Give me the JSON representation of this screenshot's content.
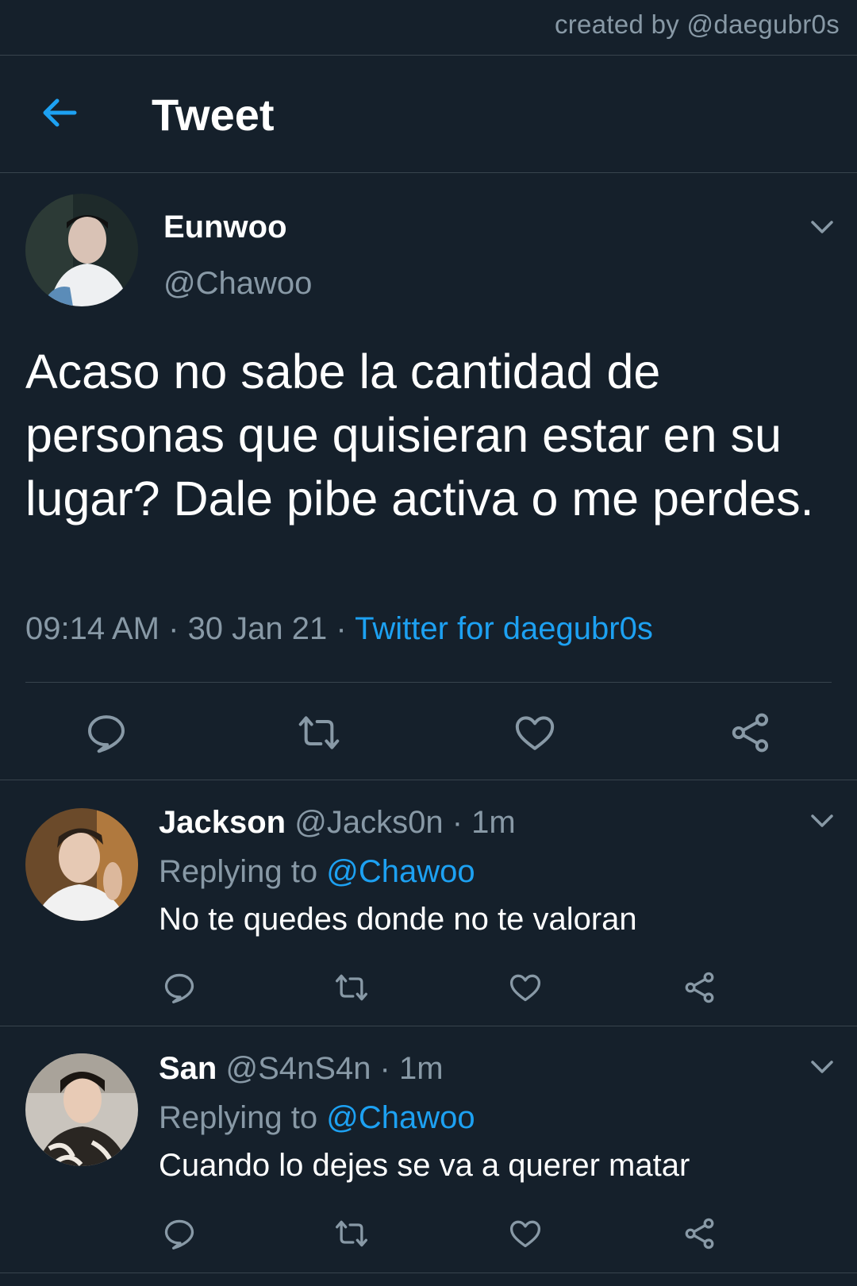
{
  "credit": "created by @daegubr0s",
  "header": {
    "title": "Tweet",
    "back_icon": "arrow-left-icon"
  },
  "colors": {
    "background": "#15202b",
    "accent": "#1da1f2",
    "muted": "#8899a6",
    "divider": "#38444d"
  },
  "main_tweet": {
    "name": "Eunwoo",
    "handle": "@Chawoo",
    "text": "Acaso no sabe la cantidad de personas que quisieran estar en su lugar? Dale pibe activa o me perdes.",
    "time": "09:14 AM",
    "sep1": " · ",
    "date": "30 Jan 21",
    "sep2": " · ",
    "source": "Twitter for daegubr0s",
    "actions": [
      "reply-icon",
      "retweet-icon",
      "like-icon",
      "share-icon"
    ]
  },
  "replies": [
    {
      "name": "Jackson",
      "handle": "@Jacks0n",
      "time": " · 1m",
      "replying_prefix": "Replying to ",
      "replying_to": "@Chawoo",
      "text": "No te quedes donde no te valoran"
    },
    {
      "name": "San",
      "handle": "@S4nS4n",
      "time": " · 1m",
      "replying_prefix": "Replying to ",
      "replying_to": "@Chawoo",
      "text": "Cuando lo dejes se va a querer matar"
    }
  ]
}
